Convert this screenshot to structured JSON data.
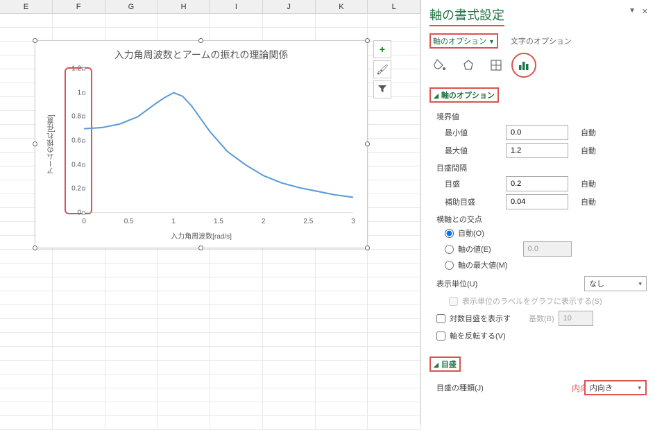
{
  "columns": [
    "E",
    "F",
    "G",
    "H",
    "I",
    "J",
    "K",
    "L"
  ],
  "chart_data": {
    "type": "line",
    "title": "入力角周波数とアームの振れの理論関係",
    "xlabel": "入力角周波数[rad/s]",
    "ylabel": "アームの振れ[任意]",
    "xlim": [
      0,
      3
    ],
    "ylim": [
      0,
      1.2
    ],
    "x_ticks": [
      "0",
      "0.5",
      "1",
      "1.5",
      "2",
      "2.5",
      "3"
    ],
    "y_ticks": [
      "0",
      "0.2",
      "0.4",
      "0.6",
      "0.8",
      "1",
      "1.2"
    ],
    "x": [
      0,
      0.2,
      0.4,
      0.6,
      0.8,
      0.9,
      1.0,
      1.1,
      1.2,
      1.4,
      1.6,
      1.8,
      2.0,
      2.2,
      2.4,
      2.6,
      2.8,
      3.0
    ],
    "y": [
      0.7,
      0.71,
      0.74,
      0.8,
      0.91,
      0.96,
      1.0,
      0.97,
      0.89,
      0.68,
      0.51,
      0.4,
      0.31,
      0.25,
      0.21,
      0.18,
      0.15,
      0.13
    ]
  },
  "side_buttons": {
    "add": "+",
    "brush": "🖌",
    "filter": "▼"
  },
  "pane": {
    "title": "軸の書式設定",
    "cat1": "軸のオプション",
    "cat2": "文字のオプション",
    "section_axis_options": "軸のオプション",
    "bounds_label": "境界値",
    "min_label": "最小値",
    "min_value": "0.0",
    "max_label": "最大値",
    "max_value": "1.2",
    "auto": "自動",
    "unit_label": "目盛間隔",
    "major_label": "目盛",
    "major_value": "0.2",
    "minor_label": "補助目盛",
    "minor_value": "0.04",
    "cross_label": "横軸との交点",
    "radio_auto": "自動(O)",
    "radio_value": "軸の値(E)",
    "radio_value_input": "0.0",
    "radio_max": "軸の最大値(M)",
    "display_unit_label": "表示単位(U)",
    "display_unit_value": "なし",
    "display_unit_check": "表示単位のラベルをグラフに表示する(S)",
    "log_label": "対数目盛を表示す",
    "log_base_label": "基数(B)",
    "log_base_value": "10",
    "reverse_label": "軸を反転する(V)",
    "section_ticks": "目盛",
    "tick_type_label": "目盛の種類(J)",
    "tick_type_value": "内向き",
    "annotation": "内向きの目盛を追加"
  }
}
